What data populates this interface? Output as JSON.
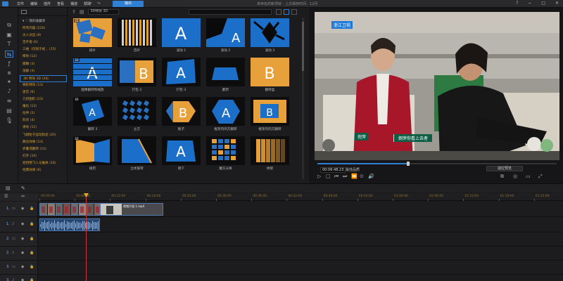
{
  "titlebar": {
    "menu": [
      "文件",
      "编辑",
      "插件",
      "查看",
      "播放",
      "帮助"
    ],
    "undo_icon": "undo-icon",
    "redo_icon": "redo-icon",
    "output_label": "输出",
    "project_title": "未命名的新项目 - 上次保存时间：12月"
  },
  "categories": {
    "header": "我的收藏夹",
    "items": [
      "所有内容 (226)",
      "淡入淡出 (8)",
      "百叶窗 (6)",
      "三维（仅限于视... (15)",
      "擦除 (12)",
      "模糊 (3)",
      "溶解 (4)",
      "3D 特效 3D (34)",
      "梯形特效 (13)",
      "迷宫 (6)",
      "几何图形 (23)",
      "推拉 (13)",
      "拉伸 (5)",
      "形状 (4)",
      "滑动 (11)",
      "飞翔粒子运动轨迹 (20)",
      "舞台效果 (13)",
      "折叠或翻转 (14)",
      "打开 (10)",
      "遮挡物飞入与推离 (18)",
      "经典效果 (6)"
    ],
    "selected_index": 7
  },
  "library": {
    "dropdown": "3D特效 3D",
    "effects": [
      "碎片",
      "百叶",
      "滚动 1",
      "滚动 2",
      "滚动 3",
      "图像翻转和缩放",
      "打包 2",
      "打包 3",
      "翻页",
      "翻转盒",
      "翻转 3",
      "立方",
      "骰子",
      "框架内的方翻转",
      "框架内的方翻转",
      "棱页",
      "立体旋转",
      "跳下",
      "魔方分离",
      "拼接"
    ]
  },
  "preview": {
    "station_logo": "浙江卫视",
    "caption_name": "倪萍",
    "caption_text": "倒萍你看上去者",
    "timecode": "00:06:48.23",
    "quality": "最佳品质",
    "zoom": "适应预览",
    "progress": 0.38
  },
  "timeline": {
    "ruler": [
      "00:00:00",
      "00:06:00",
      "00:12:00",
      "00:18:00",
      "00:24:00",
      "00:30:00",
      "00:36:00",
      "00:42:00",
      "00:48:00",
      "00:54:00",
      "01:00:00",
      "01:06:00",
      "01:12:00",
      "01:18:00",
      "01:24:00"
    ],
    "tracks": [
      {
        "num": "1."
      },
      {
        "num": "1."
      },
      {
        "num": "2."
      },
      {
        "num": "2."
      },
      {
        "num": "3."
      },
      {
        "num": "3."
      }
    ],
    "clip2_label": "视频片段 1.mp4"
  },
  "colors": {
    "accent": "#2f7fd4",
    "category_text": "#d6a033",
    "playhead": "#cc3333"
  }
}
